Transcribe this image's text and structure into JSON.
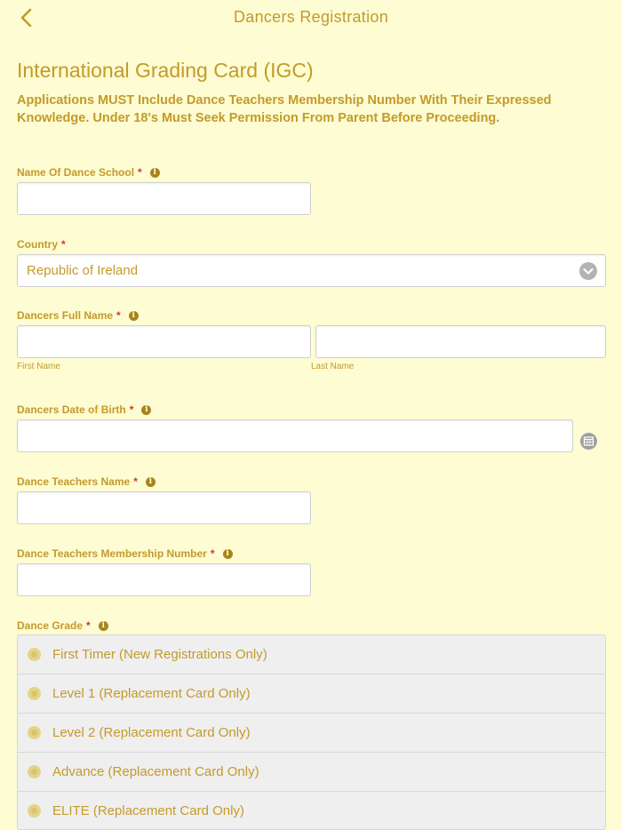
{
  "nav": {
    "title": "Dancers Registration",
    "back_icon": "chevron-left-icon"
  },
  "page": {
    "title": "International Grading Card (IGC)",
    "intro": "Applications MUST Include Dance Teachers Membership Number With Their Expressed Knowledge. Under 18's Must Seek Permission From Parent Before Proceeding."
  },
  "fields": {
    "school": {
      "label": "Name Of Dance School",
      "required": "*",
      "value": ""
    },
    "country": {
      "label": "Country",
      "required": "*",
      "value": "Republic of Ireland"
    },
    "name": {
      "label": "Dancers Full Name",
      "required": "*",
      "first_sub": "First Name",
      "last_sub": "Last Name",
      "first_value": "",
      "last_value": ""
    },
    "dob": {
      "label": "Dancers Date of Birth",
      "required": "*",
      "value": ""
    },
    "teacher": {
      "label": "Dance Teachers Name",
      "required": "*",
      "value": ""
    },
    "membership": {
      "label": "Dance Teachers Membership Number",
      "required": "*",
      "value": ""
    },
    "grade": {
      "label": "Dance Grade",
      "required": "*",
      "options": [
        "First Timer (New Registrations Only)",
        "Level 1 (Replacement Card Only)",
        "Level 2 (Replacement Card Only)",
        "Advance (Replacement Card Only)",
        "ELITE (Replacement Card Only)"
      ]
    }
  },
  "info_icon_glyph": "i",
  "colors": {
    "background": "#fdfcd2",
    "text": "#c49a2a",
    "required": "#e0302a"
  }
}
